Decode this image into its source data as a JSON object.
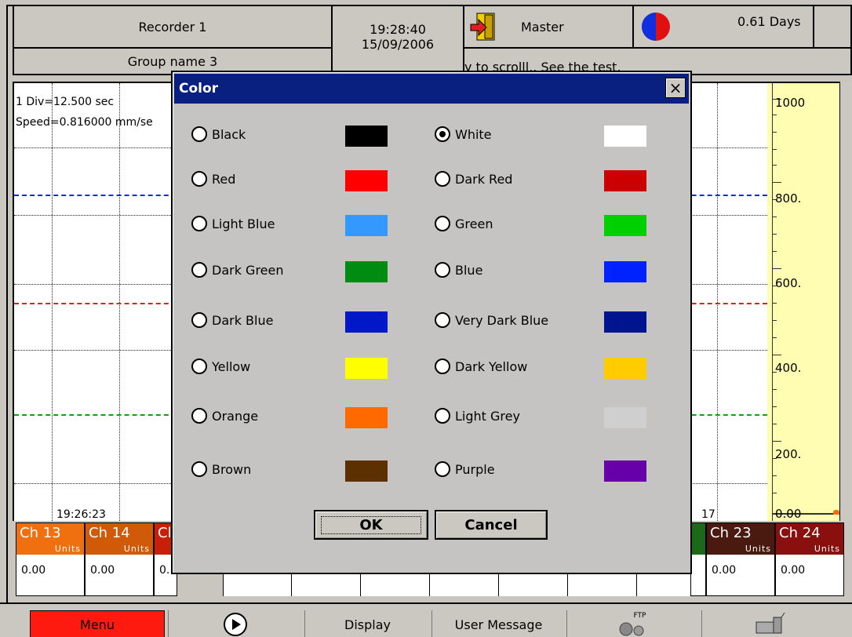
{
  "header": {
    "recorder_name": "Recorder 1",
    "group_name": "Group name 3",
    "time": "19:28:40",
    "date": "15/09/2006",
    "user": "Master",
    "days": "0.61 Days",
    "scroll_message": "y to scrolll.. See the test."
  },
  "chart": {
    "div_label": "1 Div=12.500 sec",
    "speed_label": "Speed=0.816000 mm/se",
    "time_left": "19:26:23",
    "time_right": "17",
    "scale_labels": [
      "1000",
      "800.",
      "600.",
      "400.",
      "200.",
      "0.00"
    ],
    "trace_colors": {
      "blue": "#1030e0",
      "red": "#e02020",
      "green": "#10a010"
    }
  },
  "channels_left": [
    {
      "name": "Ch 13",
      "units": "Units",
      "value": "0.00",
      "color": "#f07010"
    },
    {
      "name": "Ch 14",
      "units": "Units",
      "value": "0.00",
      "color": "#d05a08"
    },
    {
      "name": "Cl",
      "units": "",
      "value": "0.",
      "color": "#c82008"
    }
  ],
  "channels_right": [
    {
      "name": "Ch 23",
      "units": "Units",
      "value": "0.00",
      "color": "#4a1a10"
    },
    {
      "name": "Ch 24",
      "units": "Units",
      "value": "0.00",
      "color": "#8a1010"
    }
  ],
  "toolbar": {
    "menu": "Menu",
    "display": "Display",
    "user_message": "User Message",
    "ftp": "FTP"
  },
  "dialog": {
    "title": "Color",
    "close": "×",
    "ok": "OK",
    "cancel": "Cancel",
    "selected": "White",
    "left_options": [
      {
        "label": "Black",
        "color": "#000000"
      },
      {
        "label": "Red",
        "color": "#ff0000"
      },
      {
        "label": "Light Blue",
        "color": "#3399ff"
      },
      {
        "label": "Dark Green",
        "color": "#008c10"
      },
      {
        "label": "Dark Blue",
        "color": "#0018c8"
      },
      {
        "label": "Yellow",
        "color": "#ffff00"
      },
      {
        "label": "Orange",
        "color": "#ff6a00"
      },
      {
        "label": "Brown",
        "color": "#5c3000"
      }
    ],
    "right_options": [
      {
        "label": "White",
        "color": "#ffffff"
      },
      {
        "label": "Dark Red",
        "color": "#cc0000"
      },
      {
        "label": "Green",
        "color": "#00d000"
      },
      {
        "label": "Blue",
        "color": "#0022ff"
      },
      {
        "label": "Very Dark Blue",
        "color": "#001490"
      },
      {
        "label": "Dark Yellow",
        "color": "#ffcc00"
      },
      {
        "label": "Light Grey",
        "color": "#cfcfcf"
      },
      {
        "label": "Purple",
        "color": "#6600a8"
      }
    ]
  }
}
